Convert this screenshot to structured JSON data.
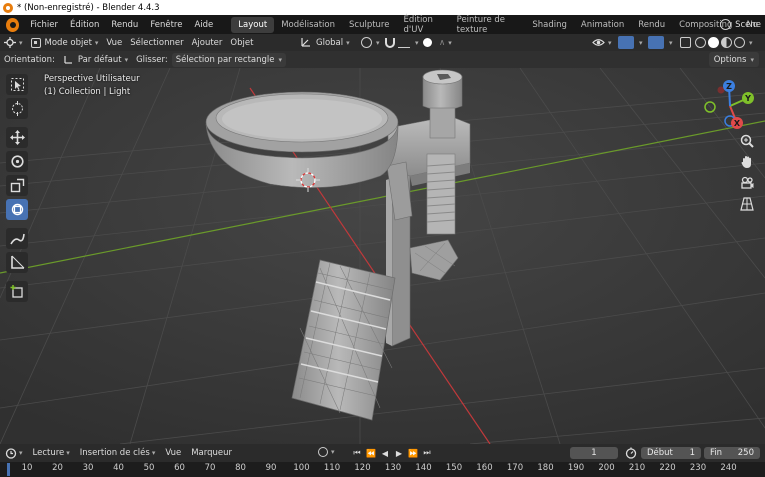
{
  "window": {
    "title": "* (Non-enregistré) - Blender 4.4.3"
  },
  "menubar": {
    "items": [
      "Fichier",
      "Édition",
      "Rendu",
      "Fenêtre",
      "Aide"
    ],
    "workspaces": [
      "Layout",
      "Modélisation",
      "Sculpture",
      "Édition d'UV",
      "Peinture de texture",
      "Shading",
      "Animation",
      "Rendu",
      "Compositing",
      "No"
    ],
    "active_workspace": "Layout",
    "scene": "Scene"
  },
  "header": {
    "mode": "Mode objet",
    "menus": [
      "Vue",
      "Sélectionner",
      "Ajouter",
      "Objet"
    ],
    "transform_orientation": "Global"
  },
  "tool_options": {
    "orientation_label": "Orientation:",
    "orientation_value": "Par défaut",
    "drag_label": "Glisser:",
    "drag_value": "Sélection par rectangle",
    "options_label": "Options"
  },
  "viewport": {
    "view_name": "Perspective Utilisateur",
    "collection_info": "(1) Collection | Light",
    "gizmo_axes": [
      "X",
      "Y",
      "Z"
    ],
    "colors": {
      "x_axis": "#e04a4a",
      "y_axis": "#7fc02a",
      "z_axis": "#3b7fe0",
      "grid": "#4a4a4a",
      "mesh": "#9b9b9b"
    }
  },
  "toolbar": {
    "tools": [
      "select-box",
      "cursor",
      "move",
      "rotate",
      "scale",
      "transform",
      "annotate",
      "measure",
      "add-cube"
    ],
    "active": "transform"
  },
  "timeline": {
    "menus": [
      "Lecture",
      "Insertion de clés",
      "Vue",
      "Marqueur"
    ],
    "current_frame": "1",
    "start_label": "Début",
    "start_value": "1",
    "end_label": "Fin",
    "end_value": "250",
    "ruler_ticks": [
      "10",
      "20",
      "30",
      "40",
      "50",
      "60",
      "70",
      "80",
      "90",
      "100",
      "110",
      "120",
      "130",
      "140",
      "150",
      "160",
      "170",
      "180",
      "190",
      "200",
      "210",
      "220",
      "230",
      "240"
    ]
  }
}
